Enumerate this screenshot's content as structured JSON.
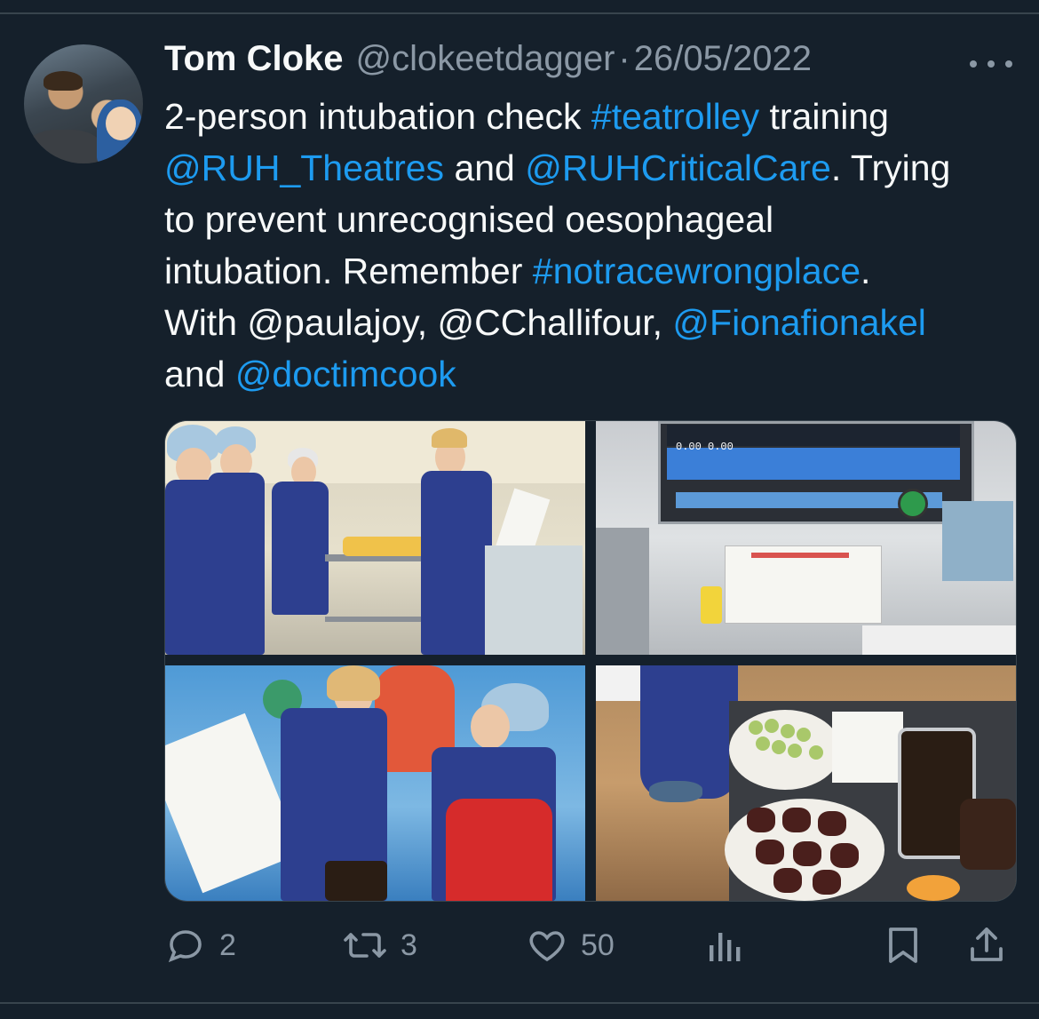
{
  "author": {
    "name": "Tom Cloke",
    "handle": "@clokeetdagger",
    "separator": "·",
    "date": "26/05/2022"
  },
  "tweet": {
    "line1": [
      {
        "text": "2-person intubation check ",
        "link": false
      },
      {
        "text": "#teatrolley",
        "link": true
      },
      {
        "text": " training",
        "link": false
      }
    ],
    "line2": [
      {
        "text": "@RUH_Theatres",
        "link": true
      },
      {
        "text": " and ",
        "link": false
      },
      {
        "text": "@RUHCriticalCare",
        "link": true
      },
      {
        "text": ". Trying",
        "link": false
      }
    ],
    "line3": [
      {
        "text": "to prevent unrecognised oesophageal",
        "link": false
      }
    ],
    "line4": [
      {
        "text": "intubation. Remember ",
        "link": false
      },
      {
        "text": "#notracewrongplace",
        "link": true
      },
      {
        "text": ".",
        "link": false
      }
    ],
    "line5": [
      {
        "text": "With @paulajoy, @CChallifour, ",
        "link": false
      },
      {
        "text": "@Fionafionakel",
        "link": true
      }
    ],
    "line6": [
      {
        "text": "and ",
        "link": false
      },
      {
        "text": "@doctimcook",
        "link": true
      }
    ]
  },
  "media": {
    "photos": [
      "photo-team-trolley",
      "photo-anaesthetic-machine",
      "photo-staff-reading-poster",
      "photo-tea-trolley-food"
    ]
  },
  "actions": {
    "replies": "2",
    "retweets": "3",
    "likes": "50"
  },
  "icons": {
    "reply": "reply-icon",
    "retweet": "retweet-icon",
    "like": "heart-icon",
    "views": "analytics-icon",
    "bookmark": "bookmark-icon",
    "share": "share-icon",
    "more": "more-icon"
  },
  "colors": {
    "background": "#15202b",
    "text": "#f7f9f9",
    "muted": "#8b98a5",
    "link": "#1d9bf0"
  }
}
